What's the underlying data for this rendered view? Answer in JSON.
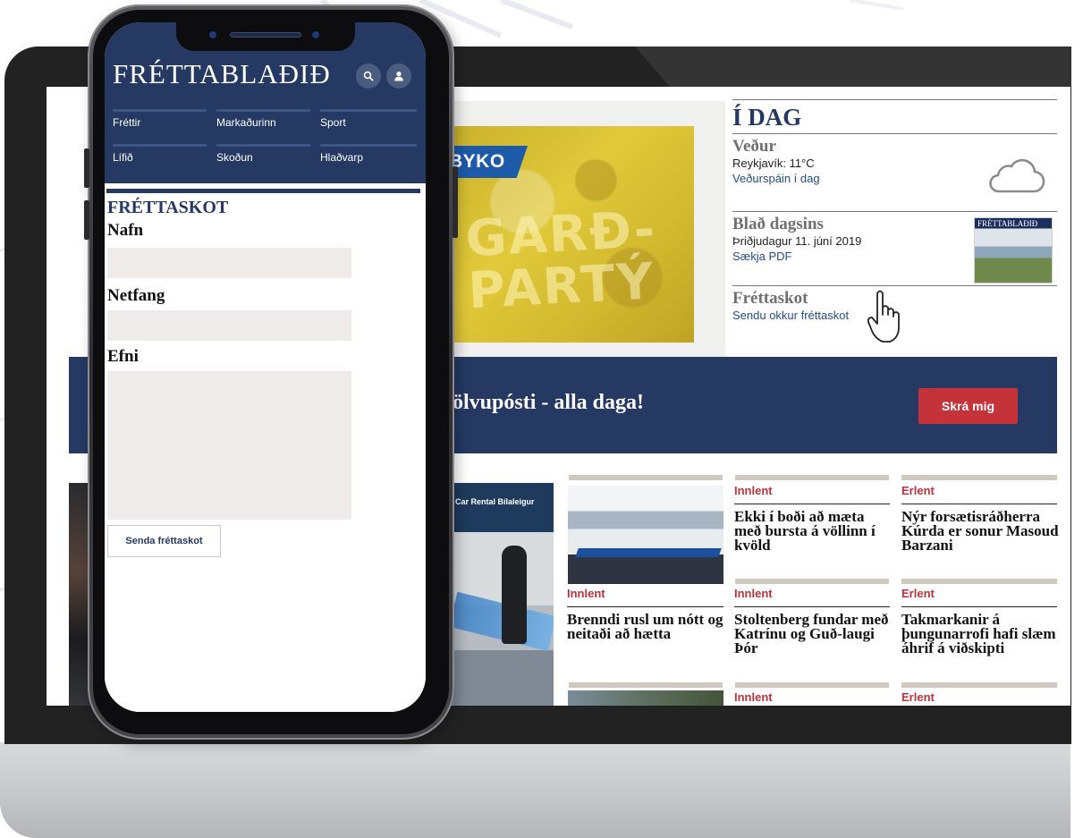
{
  "phone": {
    "logo": "FRÉTTABLAÐIÐ",
    "nav": [
      {
        "label": "Fréttir"
      },
      {
        "label": "Markaðurinn"
      },
      {
        "label": "Sport"
      },
      {
        "label": "Lífið"
      },
      {
        "label": "Skoðun"
      },
      {
        "label": "Hlaðvarp"
      }
    ],
    "form": {
      "title": "FRÉTTASKOT",
      "name_label": "Nafn",
      "email_label": "Netfang",
      "subject_label": "Efni",
      "submit_label": "Senda fréttaskot"
    }
  },
  "web": {
    "ad": {
      "brand": "BYKO",
      "headline": "GARÐ-\nPARTÝ"
    },
    "side": {
      "title": "Í DAG",
      "weather": {
        "heading": "Veður",
        "line": "Reykjavík: 11°C",
        "link": "Veðurspáin í dag"
      },
      "paper": {
        "heading": "Blað dagsins",
        "line": "Þriðjudagur 11. júní 2019",
        "link": "Sækja PDF",
        "thumb_title": "FRÉTTABLAÐIÐ"
      },
      "tip": {
        "heading": "Fréttaskot",
        "link": "Sendu okkur fréttaskot"
      }
    },
    "signup": {
      "text": "tölvupósti - alla daga!",
      "button": "Skrá mig"
    },
    "airport_sign": "Car Rental  Bílaleigur",
    "news": [
      {
        "category": "Innlent",
        "headline": "Ekki í boði að mæta með bursta á völlinn í kvöld"
      },
      {
        "category": "Erlent",
        "headline": "Nýr forsætisráðherra Kúrda er sonur Masoud Barzani"
      },
      {
        "category": "Innlent",
        "headline": "Brenndi rusl um nótt og neitaði að hætta"
      },
      {
        "category": "Innlent",
        "headline": "Stoltenberg fundar með Katrínu og Guð-laugi Þór"
      },
      {
        "category": "Erlent",
        "headline": "Takmarkanir á þungunarrofi hafi slæm áhrif á viðskipti"
      },
      {
        "category": "Innlent",
        "headline": ""
      },
      {
        "category": "Erlent",
        "headline": ""
      }
    ]
  },
  "colors": {
    "brand_navy": "#253963",
    "accent_red": "#c4333a",
    "category_red": "#b8333b",
    "side_link_blue": "#244d86",
    "ad_yellow": "#d7bf33"
  },
  "icons": [
    "search-icon",
    "user-icon",
    "cloud-icon",
    "hand-pointer-icon"
  ]
}
